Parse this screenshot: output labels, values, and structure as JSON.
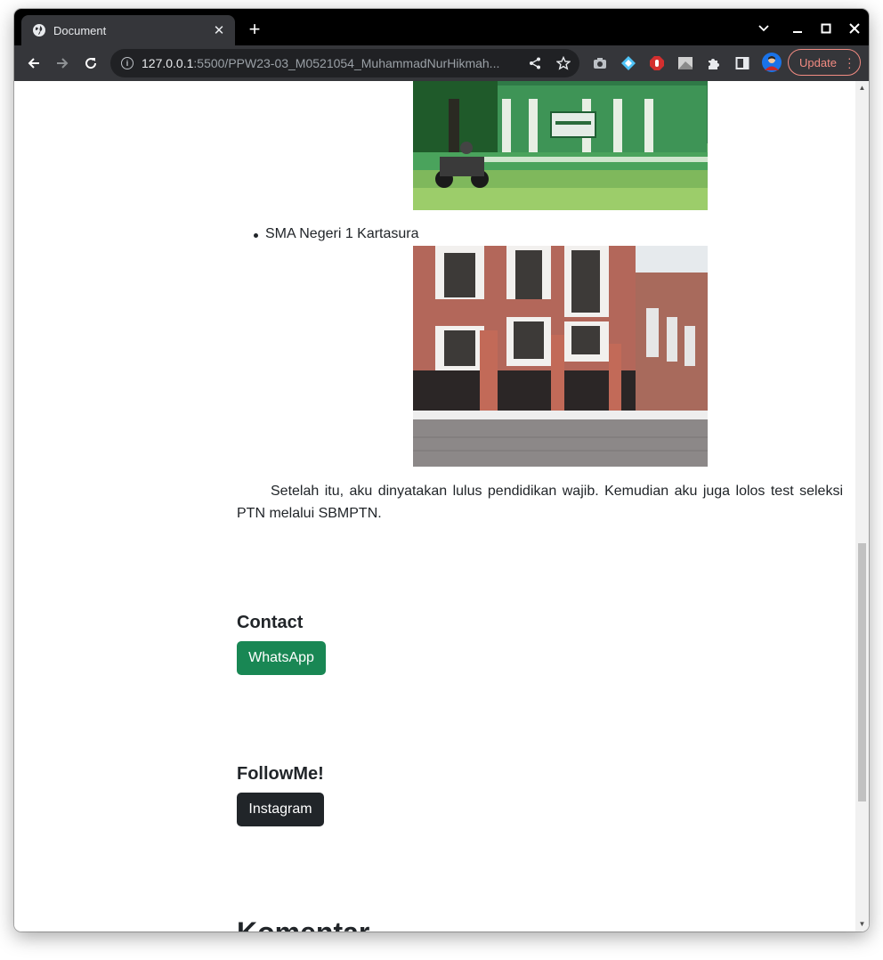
{
  "browser": {
    "tab_title": "Document",
    "url_host": "127.0.0.1",
    "url_rest": ":5500/PPW23-03_M0521054_MuhammadNurHikmah...",
    "update_label": "Update"
  },
  "content": {
    "school_item": "SMA Negeri 1 Kartasura",
    "paragraph": "Setelah itu, aku dinyatakan lulus pendidikan wajib. Kemudian aku juga lolos test seleksi PTN melalui SBMPTN.",
    "contact_heading": "Contact",
    "whatsapp_label": "WhatsApp",
    "follow_heading": "FollowMe!",
    "instagram_label": "Instagram",
    "komentar_heading": "Komentar"
  },
  "colors": {
    "whatsapp_button": "#198754",
    "instagram_button": "#212529",
    "update_accent": "#f28b82"
  },
  "icons": [
    "globe-icon",
    "close-icon",
    "plus-icon",
    "chevron-down-icon",
    "minimize-icon",
    "maximize-icon",
    "back-icon",
    "forward-icon",
    "reload-icon",
    "info-icon",
    "share-icon",
    "star-icon",
    "camera-icon",
    "extension-icon",
    "puzzle-icon",
    "sidepanel-icon",
    "avatar"
  ]
}
